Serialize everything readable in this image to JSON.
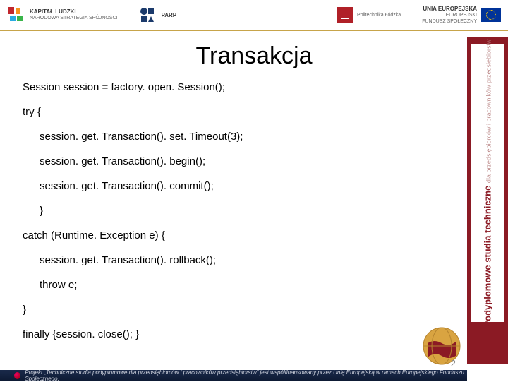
{
  "header": {
    "logos": [
      {
        "name": "KAPITAŁ LUDZKI",
        "sub": "NARODOWA STRATEGIA SPÓJNOŚCI"
      },
      {
        "name": "PARP",
        "sub": ""
      },
      {
        "name": "",
        "sub": "Politechnika Łódzka"
      },
      {
        "name": "UNIA EUROPEJSKA",
        "sub": "EUROPEJSKI\nFUNDUSZ SPOŁECZNY"
      }
    ]
  },
  "title": "Transakcja",
  "code": {
    "l1": "Session session = factory. open. Session();",
    "l2": "try {",
    "l3": "session. get. Transaction(). set. Timeout(3);",
    "l4": "session. get. Transaction(). begin();",
    "l5": "session. get. Transaction(). commit();",
    "l6": "}",
    "l7": "catch (Runtime. Exception e) {",
    "l8": "session. get. Transaction(). rollback();",
    "l9": "throw e;",
    "l10": "}",
    "l11": "finally {session. close(); }"
  },
  "sidebar": {
    "main": "Podyplomowe studia techniczne",
    "sub": "dla przedsiębiorców i pracowników przedsiębiorstw"
  },
  "footer": {
    "text": "Projekt „Techniczne studia podyplomowe dla przedsiębiorców i pracowników przedsiębiorstw” jest współfinansowany przez Unię Europejską w ramach Europejskiego Funduszu Społecznego."
  },
  "page_number": "2"
}
